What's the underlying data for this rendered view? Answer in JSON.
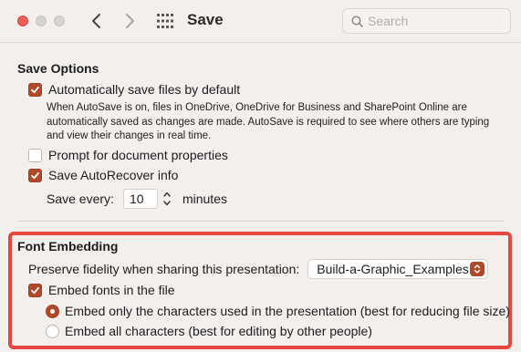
{
  "window": {
    "title": "Save",
    "search_placeholder": "Search"
  },
  "icons": {
    "close": "close-dot",
    "minimize": "minimize-dot",
    "zoom": "zoom-dot",
    "back": "chevron-left-icon",
    "forward": "chevron-right-icon",
    "show_all": "grid-icon",
    "search": "search-icon"
  },
  "colors": {
    "accent": "#b0482a",
    "highlight": "#e8473f",
    "close": "#ec5f57"
  },
  "save_options": {
    "title": "Save Options",
    "autosave": {
      "label": "Automatically save files by default",
      "checked": true,
      "description": "When AutoSave is on, files in OneDrive, OneDrive for Business and SharePoint Online are automatically saved as changes are made. AutoSave is required to see where others are typing and view their changes in real time."
    },
    "prompt_properties": {
      "label": "Prompt for document properties",
      "checked": false
    },
    "autorecover": {
      "label": "Save AutoRecover info",
      "checked": true
    },
    "save_every": {
      "label": "Save every:",
      "value": "10",
      "unit": "minutes"
    }
  },
  "font_embedding": {
    "title": "Font Embedding",
    "preserve_label": "Preserve fidelity when sharing this presentation:",
    "presentation_select": "Build-a-Graphic_Examples",
    "embed_fonts": {
      "label": "Embed fonts in the file",
      "checked": true
    },
    "options": [
      {
        "label": "Embed only the characters used in the presentation (best for reducing file size)",
        "selected": true
      },
      {
        "label": "Embed all characters (best for editing by other people)",
        "selected": false
      }
    ]
  }
}
